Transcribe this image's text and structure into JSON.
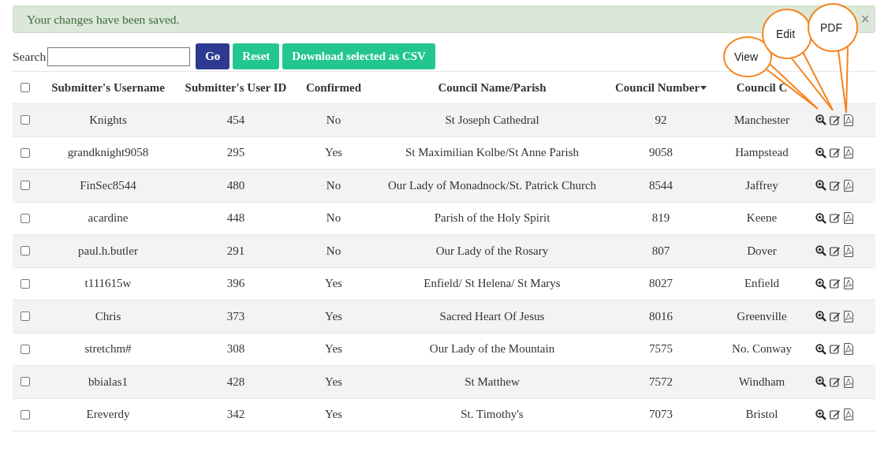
{
  "alert": {
    "message": "Your changes have been saved.",
    "close": "×"
  },
  "toolbar": {
    "search_label": "Search",
    "buttons": [
      {
        "label": "Go",
        "kind": "primary"
      },
      {
        "label": "Reset",
        "kind": "success"
      },
      {
        "label": "Download selected as CSV",
        "kind": "success"
      }
    ]
  },
  "table": {
    "select_all_checked": false,
    "columns": [
      {
        "label": "Submitter's Username",
        "sorted": false
      },
      {
        "label": "Submitter's User ID",
        "sorted": false
      },
      {
        "label": "Confirmed",
        "sorted": false
      },
      {
        "label": "Council Name/Parish",
        "sorted": false
      },
      {
        "label": "Council Number",
        "sorted": true
      },
      {
        "label": "Council C",
        "sorted": false
      }
    ],
    "rows": [
      {
        "checked": false,
        "cells": [
          "Knights",
          "454",
          "No",
          "St Joseph Cathedral",
          "92",
          "Manchester"
        ]
      },
      {
        "checked": false,
        "cells": [
          "grandknight9058",
          "295",
          "Yes",
          "St Maximilian Kolbe/St Anne Parish",
          "9058",
          "Hampstead"
        ]
      },
      {
        "checked": false,
        "cells": [
          "FinSec8544",
          "480",
          "No",
          "Our Lady of Monadnock/St. Patrick Church",
          "8544",
          "Jaffrey"
        ]
      },
      {
        "checked": false,
        "cells": [
          "acardine",
          "448",
          "No",
          "Parish of the Holy Spirit",
          "819",
          "Keene"
        ]
      },
      {
        "checked": false,
        "cells": [
          "paul.h.butler",
          "291",
          "No",
          "Our Lady of the Rosary",
          "807",
          "Dover"
        ]
      },
      {
        "checked": false,
        "cells": [
          "t111615w",
          "396",
          "Yes",
          "Enfield/ St Helena/ St Marys",
          "8027",
          "Enfield"
        ]
      },
      {
        "checked": false,
        "cells": [
          "Chris",
          "373",
          "Yes",
          "Sacred Heart Of Jesus",
          "8016",
          "Greenville"
        ]
      },
      {
        "checked": false,
        "cells": [
          "stretchm#",
          "308",
          "Yes",
          "Our Lady of the Mountain",
          "7575",
          "No. Conway"
        ]
      },
      {
        "checked": false,
        "cells": [
          "bbialas1",
          "428",
          "Yes",
          "St Matthew",
          "7572",
          "Windham"
        ]
      },
      {
        "checked": false,
        "cells": [
          "Ereverdy",
          "342",
          "Yes",
          "St. Timothy's",
          "7073",
          "Bristol"
        ]
      }
    ]
  },
  "callouts": [
    {
      "label": "View"
    },
    {
      "label": "Edit"
    },
    {
      "label": "PDF"
    }
  ]
}
